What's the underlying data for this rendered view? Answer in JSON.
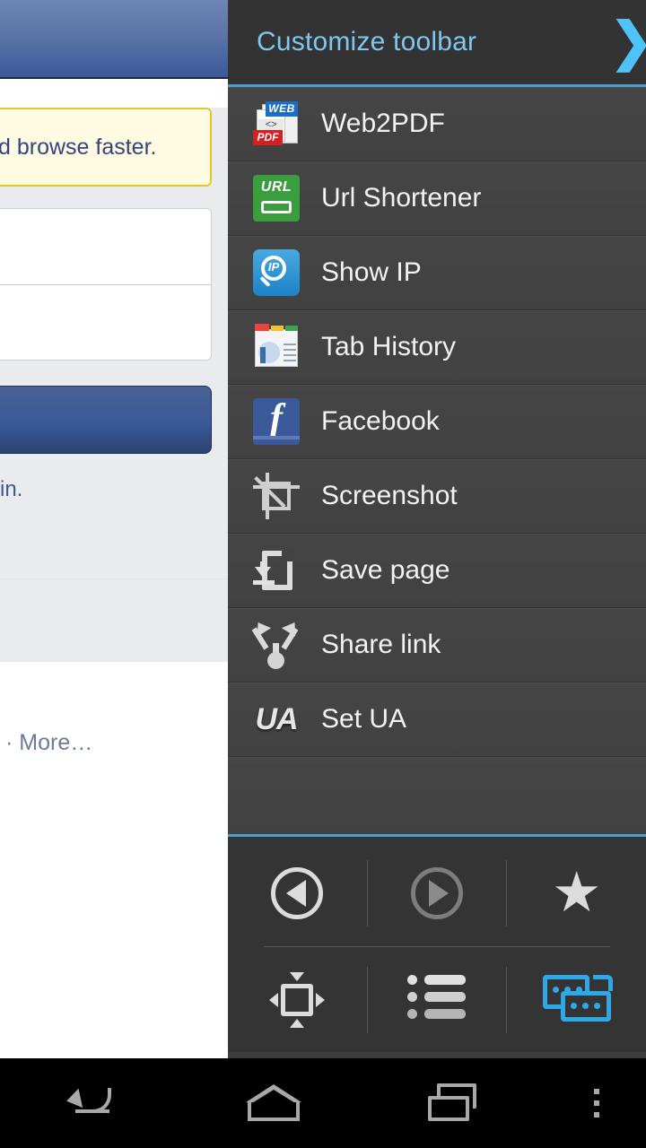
{
  "background_page": {
    "notice_text": "d browse faster.",
    "signup_text": "in.",
    "more_link": "· More…"
  },
  "panel": {
    "header": {
      "title": "Customize toolbar",
      "chevron_icon": "chevron-right-icon",
      "accent_color": "#4fc3f7",
      "divider_color": "#4a9fd0"
    },
    "addons": [
      {
        "label": "Web2PDF",
        "icon": "web2pdf-icon"
      },
      {
        "label": "Url Shortener",
        "icon": "url-shortener-icon"
      },
      {
        "label": "Show IP",
        "icon": "show-ip-icon"
      },
      {
        "label": "Tab History",
        "icon": "tab-history-icon"
      },
      {
        "label": "Facebook",
        "icon": "facebook-icon"
      },
      {
        "label": "Screenshot",
        "icon": "screenshot-crop-icon"
      },
      {
        "label": "Save page",
        "icon": "save-page-icon"
      },
      {
        "label": "Share link",
        "icon": "share-link-icon"
      },
      {
        "label": "Set UA",
        "icon": "set-ua-icon"
      }
    ],
    "toolbar": {
      "row1": [
        {
          "name": "back-button",
          "icon": "circle-back-arrow-icon",
          "state": "enabled"
        },
        {
          "name": "forward-button",
          "icon": "circle-forward-arrow-icon",
          "state": "disabled"
        },
        {
          "name": "bookmark-button",
          "icon": "star-icon",
          "state": "enabled"
        }
      ],
      "row2": [
        {
          "name": "fullscreen-button",
          "icon": "fit-page-icon",
          "state": "enabled"
        },
        {
          "name": "menu-button",
          "icon": "list-menu-icon",
          "state": "enabled"
        },
        {
          "name": "tabs-button",
          "icon": "tabs-icon",
          "state": "active"
        }
      ],
      "active_color": "#2fa8e8"
    }
  },
  "navbar": {
    "back": "back-nav-icon",
    "home": "home-nav-icon",
    "recents": "recents-nav-icon",
    "overflow": "overflow-menu-icon"
  }
}
